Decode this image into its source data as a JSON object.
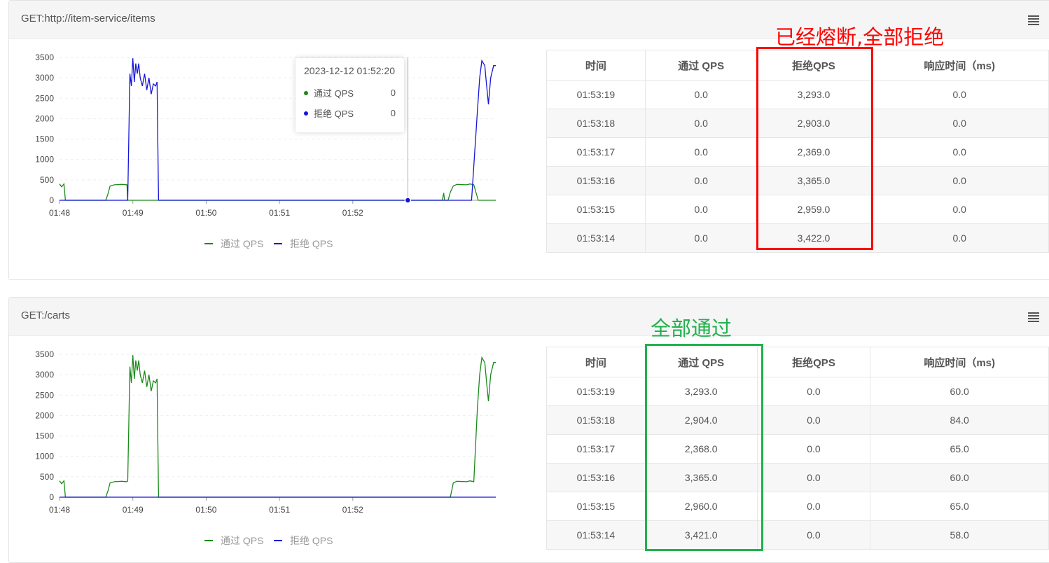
{
  "colors": {
    "pass": "#1a8a1a",
    "reject": "#1515d8",
    "annotation_red": "#ff0000",
    "annotation_green": "#22b14c"
  },
  "panels": [
    {
      "title": "GET:http://item-service/items",
      "legend": {
        "pass": "通过 QPS",
        "reject": "拒绝 QPS"
      },
      "tooltip": {
        "time": "2023-12-12 01:52:20",
        "rows": [
          {
            "label": "通过 QPS",
            "value": "0"
          },
          {
            "label": "拒绝 QPS",
            "value": "0"
          }
        ]
      },
      "table": {
        "headers": [
          "时间",
          "通过 QPS",
          "拒绝QPS",
          "响应时间（ms)"
        ],
        "rows": [
          [
            "01:53:19",
            "0.0",
            "3,293.0",
            "0.0"
          ],
          [
            "01:53:18",
            "0.0",
            "2,903.0",
            "0.0"
          ],
          [
            "01:53:17",
            "0.0",
            "2,369.0",
            "0.0"
          ],
          [
            "01:53:16",
            "0.0",
            "3,365.0",
            "0.0"
          ],
          [
            "01:53:15",
            "0.0",
            "2,959.0",
            "0.0"
          ],
          [
            "01:53:14",
            "0.0",
            "3,422.0",
            "0.0"
          ]
        ]
      },
      "annotation": "已经熔断,全部拒绝"
    },
    {
      "title": "GET:/carts",
      "legend": {
        "pass": "通过 QPS",
        "reject": "拒绝 QPS"
      },
      "table": {
        "headers": [
          "时间",
          "通过 QPS",
          "拒绝QPS",
          "响应时间（ms)"
        ],
        "rows": [
          [
            "01:53:19",
            "3,293.0",
            "0.0",
            "60.0"
          ],
          [
            "01:53:18",
            "2,904.0",
            "0.0",
            "84.0"
          ],
          [
            "01:53:17",
            "2,368.0",
            "0.0",
            "65.0"
          ],
          [
            "01:53:16",
            "3,365.0",
            "0.0",
            "60.0"
          ],
          [
            "01:53:15",
            "2,960.0",
            "0.0",
            "65.0"
          ],
          [
            "01:53:14",
            "3,421.0",
            "0.0",
            "58.0"
          ]
        ]
      },
      "annotation": "全部通过"
    }
  ],
  "chart_data": [
    {
      "type": "line",
      "x_ticks": [
        "01:48",
        "01:49",
        "01:50",
        "01:51",
        "01:52"
      ],
      "y_ticks": [
        0,
        500,
        1000,
        1500,
        2000,
        2500,
        3000,
        3500
      ],
      "ylim": [
        0,
        3500
      ],
      "xlim_min": [
        0,
        5.95
      ],
      "series": [
        {
          "name": "通过 QPS",
          "color": "#1a8a1a",
          "points": [
            [
              0,
              400
            ],
            [
              0.03,
              330
            ],
            [
              0.06,
              400
            ],
            [
              0.08,
              0
            ],
            [
              0.63,
              0
            ],
            [
              0.66,
              150
            ],
            [
              0.69,
              350
            ],
            [
              0.75,
              380
            ],
            [
              0.85,
              390
            ],
            [
              0.92,
              380
            ],
            [
              0.93,
              0
            ],
            [
              5.22,
              0
            ],
            [
              5.24,
              180
            ],
            [
              5.25,
              0
            ],
            [
              5.3,
              0
            ],
            [
              5.33,
              200
            ],
            [
              5.37,
              350
            ],
            [
              5.42,
              390
            ],
            [
              5.55,
              380
            ],
            [
              5.6,
              400
            ],
            [
              5.65,
              380
            ],
            [
              5.71,
              0
            ],
            [
              5.95,
              0
            ]
          ]
        },
        {
          "name": "拒绝 QPS",
          "color": "#1515d8",
          "points": [
            [
              0,
              0
            ],
            [
              0.93,
              0
            ],
            [
              0.96,
              3100
            ],
            [
              0.98,
              2800
            ],
            [
              1.0,
              3480
            ],
            [
              1.02,
              2900
            ],
            [
              1.04,
              3350
            ],
            [
              1.06,
              3100
            ],
            [
              1.08,
              3350
            ],
            [
              1.1,
              3000
            ],
            [
              1.13,
              2800
            ],
            [
              1.16,
              3100
            ],
            [
              1.19,
              2700
            ],
            [
              1.22,
              3000
            ],
            [
              1.25,
              2600
            ],
            [
              1.28,
              2850
            ],
            [
              1.31,
              2800
            ],
            [
              1.33,
              2900
            ],
            [
              1.35,
              0
            ],
            [
              5.62,
              0
            ],
            [
              5.7,
              2200
            ],
            [
              5.73,
              3000
            ],
            [
              5.76,
              3420
            ],
            [
              5.8,
              3300
            ],
            [
              5.82,
              2900
            ],
            [
              5.85,
              2350
            ],
            [
              5.88,
              3000
            ],
            [
              5.92,
              3300
            ],
            [
              5.95,
              3300
            ]
          ]
        }
      ]
    },
    {
      "type": "line",
      "x_ticks": [
        "01:48",
        "01:49",
        "01:50",
        "01:51",
        "01:52"
      ],
      "y_ticks": [
        0,
        500,
        1000,
        1500,
        2000,
        2500,
        3000,
        3500
      ],
      "ylim": [
        0,
        3500
      ],
      "series": [
        {
          "name": "通过 QPS",
          "color": "#1a8a1a",
          "points": [
            [
              0,
              400
            ],
            [
              0.03,
              330
            ],
            [
              0.06,
              400
            ],
            [
              0.08,
              0
            ],
            [
              0.63,
              0
            ],
            [
              0.66,
              150
            ],
            [
              0.69,
              350
            ],
            [
              0.75,
              380
            ],
            [
              0.85,
              390
            ],
            [
              0.92,
              380
            ],
            [
              0.93,
              400
            ],
            [
              0.96,
              3200
            ],
            [
              0.98,
              2800
            ],
            [
              1.0,
              3480
            ],
            [
              1.02,
              2900
            ],
            [
              1.04,
              3350
            ],
            [
              1.06,
              3100
            ],
            [
              1.08,
              3350
            ],
            [
              1.1,
              3000
            ],
            [
              1.13,
              2800
            ],
            [
              1.16,
              3100
            ],
            [
              1.19,
              2700
            ],
            [
              1.22,
              3000
            ],
            [
              1.25,
              2600
            ],
            [
              1.28,
              2850
            ],
            [
              1.31,
              2800
            ],
            [
              1.33,
              2900
            ],
            [
              1.35,
              0
            ],
            [
              5.33,
              0
            ],
            [
              5.37,
              350
            ],
            [
              5.42,
              390
            ],
            [
              5.55,
              380
            ],
            [
              5.6,
              400
            ],
            [
              5.65,
              380
            ],
            [
              5.7,
              2200
            ],
            [
              5.73,
              3000
            ],
            [
              5.76,
              3420
            ],
            [
              5.8,
              3300
            ],
            [
              5.82,
              2900
            ],
            [
              5.85,
              2350
            ],
            [
              5.88,
              3000
            ],
            [
              5.92,
              3300
            ],
            [
              5.95,
              3300
            ]
          ]
        },
        {
          "name": "拒绝 QPS",
          "color": "#1515d8",
          "points": [
            [
              0,
              0
            ],
            [
              5.95,
              0
            ]
          ]
        }
      ]
    }
  ]
}
